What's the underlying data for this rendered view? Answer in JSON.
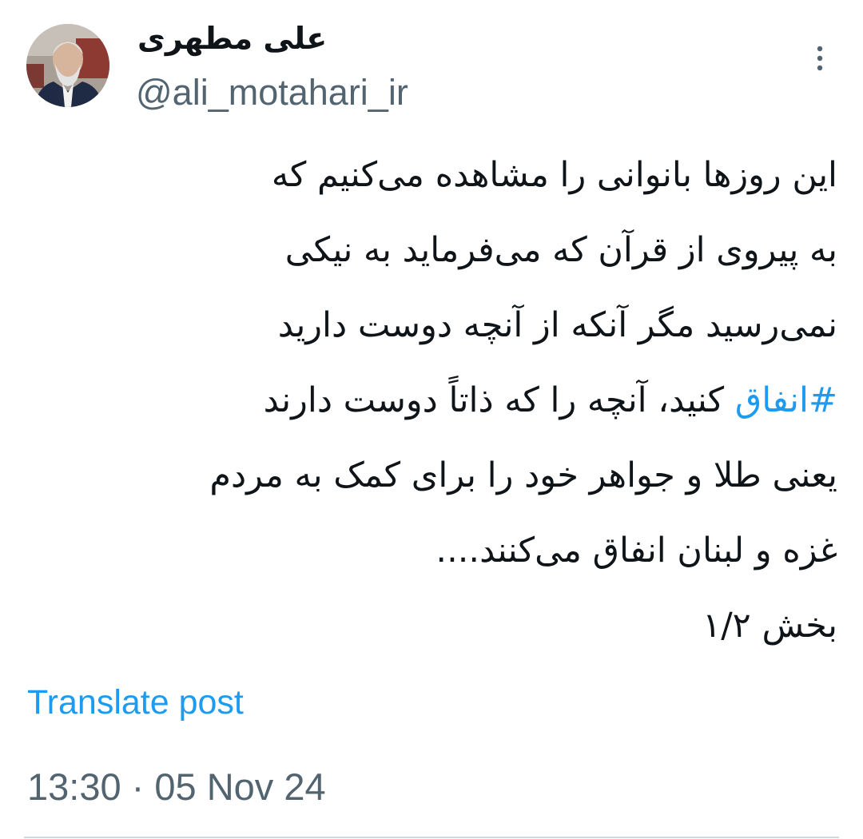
{
  "author": {
    "display_name": "علی مطهری",
    "handle": "@ali_motahari_ir",
    "avatar_icon": "profile-photo"
  },
  "menu": {
    "more_icon": "more-vertical-icon"
  },
  "post": {
    "lines": [
      {
        "text": "این روزها بانوانی را مشاهده می‌کنیم که"
      },
      {
        "text": "به پیروی از قرآن که می‌فرماید به نیکی"
      },
      {
        "text": "نمی‌رسید مگر آنکه از آنچه دوست دارید"
      },
      {
        "hashtag": "#انفاق",
        "text": " کنید، آنچه را که ذاتاً دوست دارند"
      },
      {
        "text": "یعنی طلا و جواهر خود را برای کمک به مردم"
      },
      {
        "text": "غزه و لبنان انفاق می‌کنند...."
      },
      {
        "text": "بخش ۱/۲"
      }
    ],
    "translate_label": "Translate post",
    "timestamp": "13:30 · 05 Nov 24"
  },
  "colors": {
    "link": "#1d9bf0",
    "secondary_text": "#536471",
    "primary_text": "#0f1419",
    "divider": "#cfd9de"
  }
}
